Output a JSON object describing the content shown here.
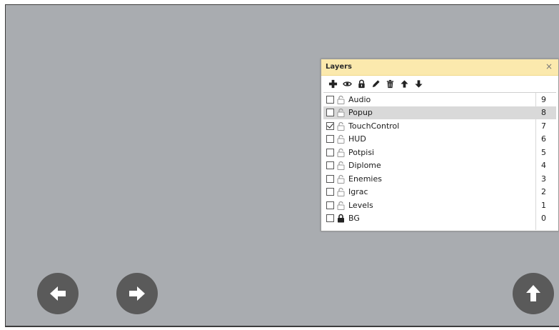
{
  "layers_panel": {
    "title": "Layers",
    "close_glyph": "×",
    "toolbar": [
      "add-icon",
      "eye-icon",
      "lock-icon",
      "pencil-icon",
      "trash-icon",
      "arrow-up-icon",
      "arrow-down-icon"
    ],
    "layers": [
      {
        "name": "Audio",
        "index": "9",
        "checked": false,
        "locked": false,
        "selected": false
      },
      {
        "name": "Popup",
        "index": "8",
        "checked": false,
        "locked": false,
        "selected": true
      },
      {
        "name": "TouchControl",
        "index": "7",
        "checked": true,
        "locked": false,
        "selected": false
      },
      {
        "name": "HUD",
        "index": "6",
        "checked": false,
        "locked": false,
        "selected": false
      },
      {
        "name": "Potpisi",
        "index": "5",
        "checked": false,
        "locked": false,
        "selected": false
      },
      {
        "name": "Diplome",
        "index": "4",
        "checked": false,
        "locked": false,
        "selected": false
      },
      {
        "name": "Enemies",
        "index": "3",
        "checked": false,
        "locked": false,
        "selected": false
      },
      {
        "name": "Igrac",
        "index": "2",
        "checked": false,
        "locked": false,
        "selected": false
      },
      {
        "name": "Levels",
        "index": "1",
        "checked": false,
        "locked": false,
        "selected": false
      },
      {
        "name": "BG",
        "index": "0",
        "checked": false,
        "locked": true,
        "selected": false
      }
    ]
  },
  "touch_controls": [
    "left-arrow-icon",
    "right-arrow-icon",
    "up-arrow-icon"
  ],
  "colors": {
    "canvas": "#a9acb0",
    "panel_header": "#fbe9ad",
    "selected_row": "#d9d9d9",
    "control_button": "#5a5a5a"
  }
}
